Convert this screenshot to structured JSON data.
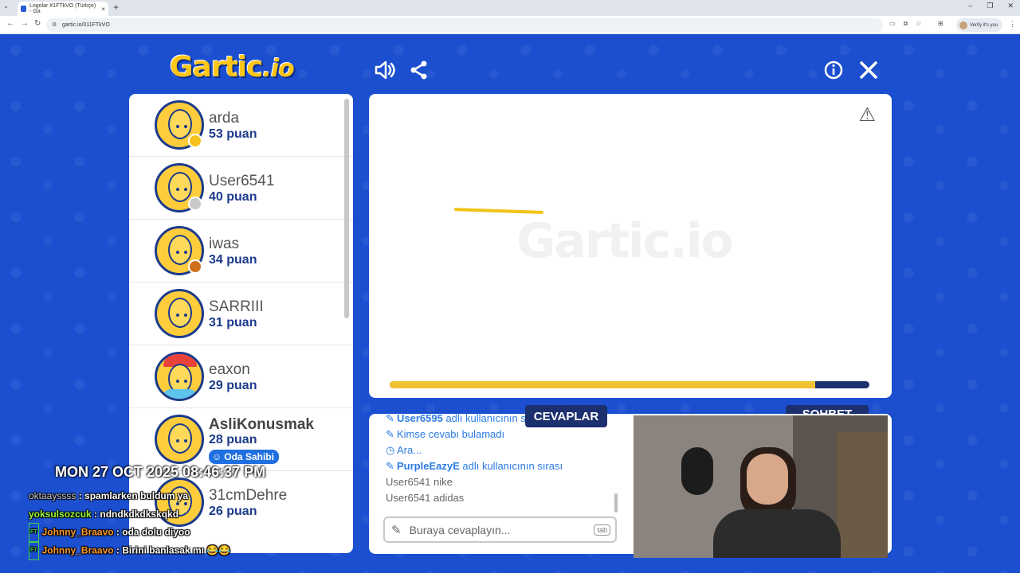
{
  "browser": {
    "tab_title": "Logolar #1FTkVO (Türkçe) - Ga",
    "url": "gartic.io/011FTkVO",
    "profile_label": "Verify it's you",
    "new_tab_icon": "+",
    "tab_close_icon": "×"
  },
  "game": {
    "logo_main": "Gartic",
    "logo_suffix": ".io",
    "players": [
      {
        "name": "arda",
        "points": "53 puan",
        "medal_color": "#f6c11d"
      },
      {
        "name": "User6541",
        "points": "40 puan",
        "medal_color": "#c9c9c9"
      },
      {
        "name": "iwas",
        "points": "34 puan",
        "medal_color": "#d0701c"
      },
      {
        "name": "SARRIII",
        "points": "31 puan",
        "medal_color": ""
      },
      {
        "name": "eaxon",
        "points": "29 puan",
        "medal_color": ""
      },
      {
        "name": "AsliKonusmak",
        "points": "28 puan",
        "badge": "Oda Sahibi"
      },
      {
        "name": "31cmDehre",
        "points": "26 puan"
      }
    ],
    "canvas": {
      "watermark": "Gartic.io",
      "timer_progress": 0.89
    },
    "tabs": {
      "answers": "CEVAPLAR",
      "chat": "SOHBET"
    },
    "answers": [
      {
        "icon": "pencil",
        "bold": "User6595",
        "text": " adlı kullanıcının sırası",
        "style": "blue"
      },
      {
        "icon": "pencil",
        "bold": "",
        "text": "Kimse cevabı bulamadı",
        "style": "blue"
      },
      {
        "icon": "clock",
        "bold": "",
        "text": "Ara...",
        "style": "blue"
      },
      {
        "icon": "pencil",
        "bold": "PurpleEazyE",
        "text": " adlı kullanıcının sırası",
        "style": "blue"
      },
      {
        "icon": "",
        "bold": "",
        "text": "User6541 nike",
        "style": "plain"
      },
      {
        "icon": "",
        "bold": "",
        "text": "User6541 adidas",
        "style": "plain"
      }
    ],
    "answer_input": {
      "placeholder": "Buraya cevaplayın...",
      "tab_hint": "tab"
    }
  },
  "overlay": {
    "datetime": "MON 27 OCT 2025 08:46:37 PM",
    "chat": [
      {
        "badge": "",
        "user": "oktaayssss",
        "message": "spamlarken buldum ya",
        "user_style": "u1"
      },
      {
        "badge": "",
        "user": "yoksulsozcuk",
        "message": "ndndkdkdkskqkd",
        "user_style": "u2"
      },
      {
        "badge": "FT",
        "user": "Johnny_Braavo",
        "message": "oda dolu diyoo",
        "user_style": "u3"
      },
      {
        "badge": "FT",
        "user": "Johnny_Braavo",
        "message": "Birini banlasak mı 😂😂",
        "user_style": "u3"
      }
    ]
  }
}
